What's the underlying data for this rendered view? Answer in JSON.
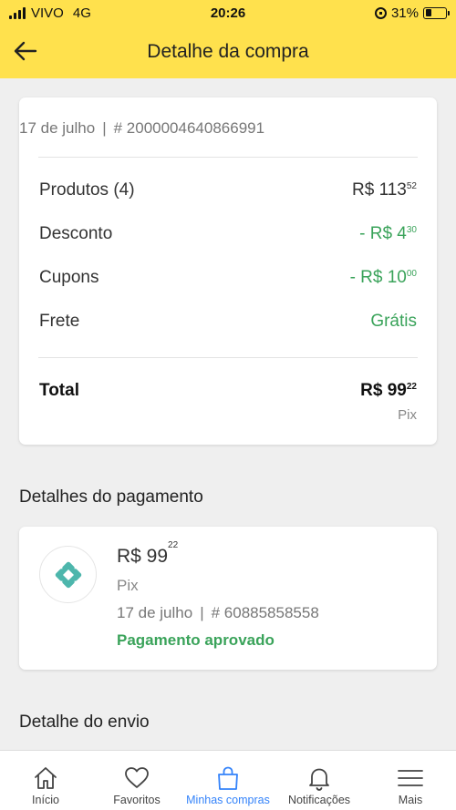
{
  "status_bar": {
    "carrier": "VIVO",
    "network": "4G",
    "time": "20:26",
    "battery": "31%",
    "battery_level": 0.31
  },
  "header": {
    "title": "Detalhe da compra",
    "back_icon": "arrow-left-icon"
  },
  "summary": {
    "date": "17 de julho",
    "separator": "|",
    "order_number": "# 2000004640866991",
    "rows": [
      {
        "label": "Produtos (4)",
        "amount_main": "R$ 113",
        "amount_cents": "52"
      },
      {
        "label": "Desconto",
        "amount_main": "- R$ 4",
        "amount_cents": "30"
      },
      {
        "label": "Cupons",
        "amount_main": "- R$ 10",
        "amount_cents": "00"
      },
      {
        "label": "Frete",
        "amount_text": "Grátis"
      }
    ],
    "total": {
      "label": "Total",
      "amount_main": "R$ 99",
      "amount_cents": "22",
      "method": "Pix"
    }
  },
  "payment_section": {
    "title": "Detalhes do pagamento",
    "icon": "pix-icon",
    "amount_main": "R$ 99",
    "amount_cents": "22",
    "method": "Pix",
    "date": "17 de julho",
    "separator": "|",
    "transaction": "# 60885858558",
    "status": "Pagamento aprovado"
  },
  "shipping_section": {
    "title": "Detalhe do envio"
  },
  "bottom_nav": {
    "items": [
      {
        "label": "Início",
        "icon": "home-icon"
      },
      {
        "label": "Favoritos",
        "icon": "heart-icon"
      },
      {
        "label": "Minhas compras",
        "icon": "shopping-bag-icon",
        "active": true
      },
      {
        "label": "Notificações",
        "icon": "bell-icon"
      },
      {
        "label": "Mais",
        "icon": "menu-icon"
      }
    ]
  },
  "colors": {
    "brand_yellow": "#ffe14d",
    "positive_green": "#3aa35a",
    "active_blue": "#3483fa",
    "pix_teal": "#4db6ac"
  }
}
